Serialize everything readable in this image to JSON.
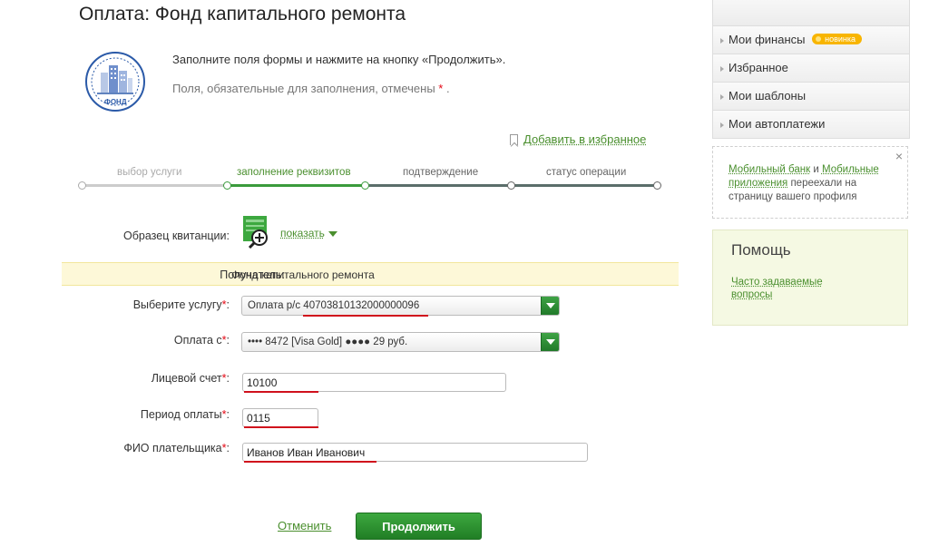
{
  "page": {
    "title": "Оплата: Фонд капитального ремонта",
    "intro_line1": "Заполните поля формы и нажмите на кнопку «Продолжить».",
    "intro_line2": "Поля, обязательные для заполнения, отмечены",
    "required_mark": "*",
    "intro_line2_end": ".",
    "logo_text": "ФОНД",
    "add_favorite": "Добавить в избранное"
  },
  "steps": [
    {
      "label": "выбор услуги",
      "state": "done"
    },
    {
      "label": "заполнение реквизитов",
      "state": "active"
    },
    {
      "label": "подтверждение",
      "state": "pending"
    },
    {
      "label": "статус операции",
      "state": "pending"
    }
  ],
  "receipt": {
    "label": "Образец квитанции:",
    "show_link": "показать"
  },
  "form": {
    "recipient_label": "Получатель:",
    "recipient_value": "Фонд капитального ремонта",
    "service_label": "Выберите услугу",
    "service_value_prefix": "Оплата р/с ",
    "service_value_account": "40703810132000000096",
    "payfrom_label": "Оплата с",
    "payfrom_value": "•••• 8472 [Visa Gold] ●●●● 29 руб.",
    "account_label": "Лицевой счет",
    "account_value": "10100",
    "period_label": "Период оплаты",
    "period_value": "0115",
    "name_label": "ФИО плательщика",
    "name_value": "Иванов Иван Иванович",
    "required_mark": "*",
    "colon": ":"
  },
  "actions": {
    "cancel": "Отменить",
    "continue": "Продолжить"
  },
  "sidebar": {
    "items": [
      {
        "label": "Мои финансы",
        "badge": "новинка"
      },
      {
        "label": "Избранное"
      },
      {
        "label": "Мои шаблоны"
      },
      {
        "label": "Мои автоплатежи"
      }
    ],
    "notice": {
      "link1": "Мобильный банк",
      "and": " и ",
      "link2": "Мобильные приложения",
      "text": " переехали на страницу вашего профиля",
      "close": "×"
    },
    "help": {
      "title": "Помощь",
      "faq": "Часто задаваемые вопросы"
    }
  },
  "colors": {
    "accent_green": "#4a8f2e",
    "button_green": "#2a8f2f",
    "required_red": "#e30613",
    "underline_red": "#d0101c",
    "recipient_bg": "#fdf8d8"
  }
}
